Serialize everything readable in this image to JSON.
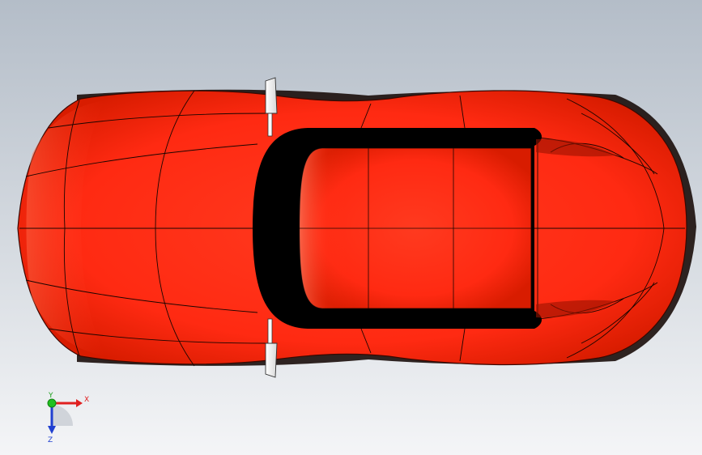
{
  "viewport": {
    "background_top": "#b4bdc8",
    "background_bottom": "#f2f4f6",
    "model": {
      "name": "sports-car-top-view",
      "body_color": "#ff2e17",
      "body_highlight": "#ff7a5c",
      "body_shadow": "#c81800",
      "window_color": "#000000",
      "edge_color": "#000000"
    }
  },
  "triad": {
    "x_label": "X",
    "y_label": "Y",
    "z_label": "Z",
    "x_color": "#e02020",
    "y_color": "#20c020",
    "z_color": "#2040d0"
  }
}
